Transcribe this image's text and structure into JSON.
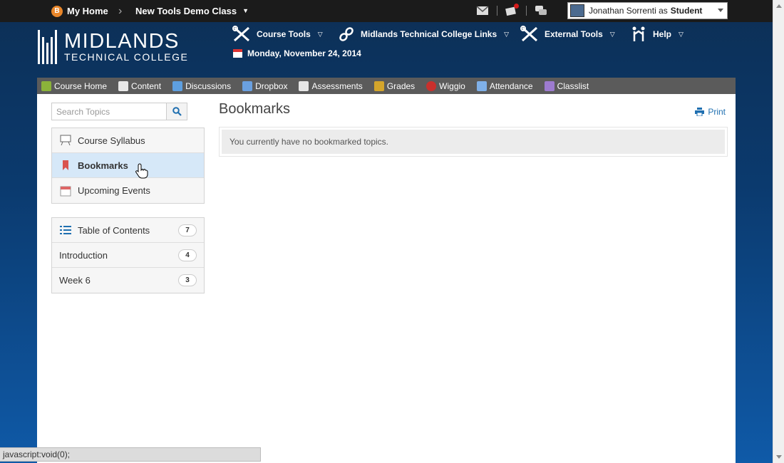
{
  "topbar": {
    "home_label": "My Home",
    "course_label": "New Tools Demo Class",
    "user_name": "Jonathan Sorrenti as",
    "user_role": "Student"
  },
  "header": {
    "logo_line1": "MIDLANDS",
    "logo_line2": "TECHNICAL COLLEGE",
    "nav": [
      {
        "label": "Course Tools",
        "icon": "tools-icon"
      },
      {
        "label": "Midlands Technical College Links",
        "icon": "link-icon"
      },
      {
        "label": "External Tools",
        "icon": "tools-icon"
      },
      {
        "label": "Help",
        "icon": "help-people-icon"
      }
    ],
    "date": "Monday, November 24, 2014"
  },
  "navbar": {
    "items": [
      {
        "label": "Course Home",
        "icon": "book-icon",
        "color": "#8bb33a"
      },
      {
        "label": "Content",
        "icon": "pages-icon",
        "color": "#e8e8e8"
      },
      {
        "label": "Discussions",
        "icon": "chat-icon",
        "color": "#5e9fe0"
      },
      {
        "label": "Dropbox",
        "icon": "dropbox-icon",
        "color": "#6aa0e0"
      },
      {
        "label": "Assessments",
        "icon": "quiz-icon",
        "color": "#e6e6e6"
      },
      {
        "label": "Grades",
        "icon": "grades-icon",
        "color": "#d4a52b"
      },
      {
        "label": "Wiggio",
        "icon": "wiggio-icon",
        "color": "#c9302c"
      },
      {
        "label": "Attendance",
        "icon": "attendance-icon",
        "color": "#7fb0e8"
      },
      {
        "label": "Classlist",
        "icon": "classlist-icon",
        "color": "#9d7bd0"
      }
    ]
  },
  "sidebar": {
    "search_placeholder": "Search Topics",
    "quick_links": [
      {
        "label": "Course Syllabus",
        "icon": "syllabus-icon"
      },
      {
        "label": "Bookmarks",
        "icon": "bookmark-icon"
      },
      {
        "label": "Upcoming Events",
        "icon": "calendar-icon"
      }
    ],
    "toc": [
      {
        "label": "Table of Contents",
        "count": "7"
      },
      {
        "label": "Introduction",
        "count": "4"
      },
      {
        "label": "Week 6",
        "count": "3"
      }
    ]
  },
  "main": {
    "title": "Bookmarks",
    "print_label": "Print",
    "empty_message": "You currently have no bookmarked topics."
  },
  "statusbar": {
    "text": "javascript:void(0);"
  }
}
